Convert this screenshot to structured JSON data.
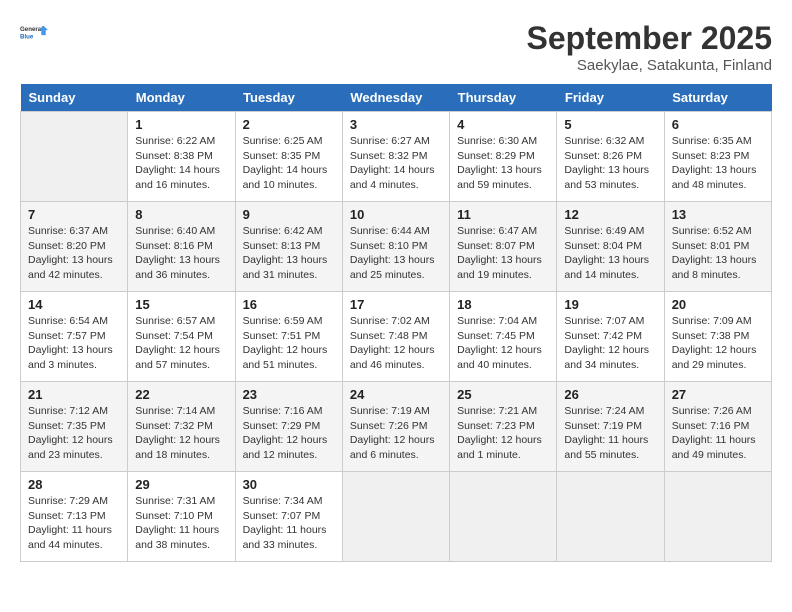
{
  "header": {
    "logo_line1": "General",
    "logo_line2": "Blue",
    "month": "September 2025",
    "location": "Saekylae, Satakunta, Finland"
  },
  "weekdays": [
    "Sunday",
    "Monday",
    "Tuesday",
    "Wednesday",
    "Thursday",
    "Friday",
    "Saturday"
  ],
  "weeks": [
    [
      {
        "day": "",
        "info": ""
      },
      {
        "day": "1",
        "info": "Sunrise: 6:22 AM\nSunset: 8:38 PM\nDaylight: 14 hours\nand 16 minutes."
      },
      {
        "day": "2",
        "info": "Sunrise: 6:25 AM\nSunset: 8:35 PM\nDaylight: 14 hours\nand 10 minutes."
      },
      {
        "day": "3",
        "info": "Sunrise: 6:27 AM\nSunset: 8:32 PM\nDaylight: 14 hours\nand 4 minutes."
      },
      {
        "day": "4",
        "info": "Sunrise: 6:30 AM\nSunset: 8:29 PM\nDaylight: 13 hours\nand 59 minutes."
      },
      {
        "day": "5",
        "info": "Sunrise: 6:32 AM\nSunset: 8:26 PM\nDaylight: 13 hours\nand 53 minutes."
      },
      {
        "day": "6",
        "info": "Sunrise: 6:35 AM\nSunset: 8:23 PM\nDaylight: 13 hours\nand 48 minutes."
      }
    ],
    [
      {
        "day": "7",
        "info": "Sunrise: 6:37 AM\nSunset: 8:20 PM\nDaylight: 13 hours\nand 42 minutes."
      },
      {
        "day": "8",
        "info": "Sunrise: 6:40 AM\nSunset: 8:16 PM\nDaylight: 13 hours\nand 36 minutes."
      },
      {
        "day": "9",
        "info": "Sunrise: 6:42 AM\nSunset: 8:13 PM\nDaylight: 13 hours\nand 31 minutes."
      },
      {
        "day": "10",
        "info": "Sunrise: 6:44 AM\nSunset: 8:10 PM\nDaylight: 13 hours\nand 25 minutes."
      },
      {
        "day": "11",
        "info": "Sunrise: 6:47 AM\nSunset: 8:07 PM\nDaylight: 13 hours\nand 19 minutes."
      },
      {
        "day": "12",
        "info": "Sunrise: 6:49 AM\nSunset: 8:04 PM\nDaylight: 13 hours\nand 14 minutes."
      },
      {
        "day": "13",
        "info": "Sunrise: 6:52 AM\nSunset: 8:01 PM\nDaylight: 13 hours\nand 8 minutes."
      }
    ],
    [
      {
        "day": "14",
        "info": "Sunrise: 6:54 AM\nSunset: 7:57 PM\nDaylight: 13 hours\nand 3 minutes."
      },
      {
        "day": "15",
        "info": "Sunrise: 6:57 AM\nSunset: 7:54 PM\nDaylight: 12 hours\nand 57 minutes."
      },
      {
        "day": "16",
        "info": "Sunrise: 6:59 AM\nSunset: 7:51 PM\nDaylight: 12 hours\nand 51 minutes."
      },
      {
        "day": "17",
        "info": "Sunrise: 7:02 AM\nSunset: 7:48 PM\nDaylight: 12 hours\nand 46 minutes."
      },
      {
        "day": "18",
        "info": "Sunrise: 7:04 AM\nSunset: 7:45 PM\nDaylight: 12 hours\nand 40 minutes."
      },
      {
        "day": "19",
        "info": "Sunrise: 7:07 AM\nSunset: 7:42 PM\nDaylight: 12 hours\nand 34 minutes."
      },
      {
        "day": "20",
        "info": "Sunrise: 7:09 AM\nSunset: 7:38 PM\nDaylight: 12 hours\nand 29 minutes."
      }
    ],
    [
      {
        "day": "21",
        "info": "Sunrise: 7:12 AM\nSunset: 7:35 PM\nDaylight: 12 hours\nand 23 minutes."
      },
      {
        "day": "22",
        "info": "Sunrise: 7:14 AM\nSunset: 7:32 PM\nDaylight: 12 hours\nand 18 minutes."
      },
      {
        "day": "23",
        "info": "Sunrise: 7:16 AM\nSunset: 7:29 PM\nDaylight: 12 hours\nand 12 minutes."
      },
      {
        "day": "24",
        "info": "Sunrise: 7:19 AM\nSunset: 7:26 PM\nDaylight: 12 hours\nand 6 minutes."
      },
      {
        "day": "25",
        "info": "Sunrise: 7:21 AM\nSunset: 7:23 PM\nDaylight: 12 hours\nand 1 minute."
      },
      {
        "day": "26",
        "info": "Sunrise: 7:24 AM\nSunset: 7:19 PM\nDaylight: 11 hours\nand 55 minutes."
      },
      {
        "day": "27",
        "info": "Sunrise: 7:26 AM\nSunset: 7:16 PM\nDaylight: 11 hours\nand 49 minutes."
      }
    ],
    [
      {
        "day": "28",
        "info": "Sunrise: 7:29 AM\nSunset: 7:13 PM\nDaylight: 11 hours\nand 44 minutes."
      },
      {
        "day": "29",
        "info": "Sunrise: 7:31 AM\nSunset: 7:10 PM\nDaylight: 11 hours\nand 38 minutes."
      },
      {
        "day": "30",
        "info": "Sunrise: 7:34 AM\nSunset: 7:07 PM\nDaylight: 11 hours\nand 33 minutes."
      },
      {
        "day": "",
        "info": ""
      },
      {
        "day": "",
        "info": ""
      },
      {
        "day": "",
        "info": ""
      },
      {
        "day": "",
        "info": ""
      }
    ]
  ]
}
